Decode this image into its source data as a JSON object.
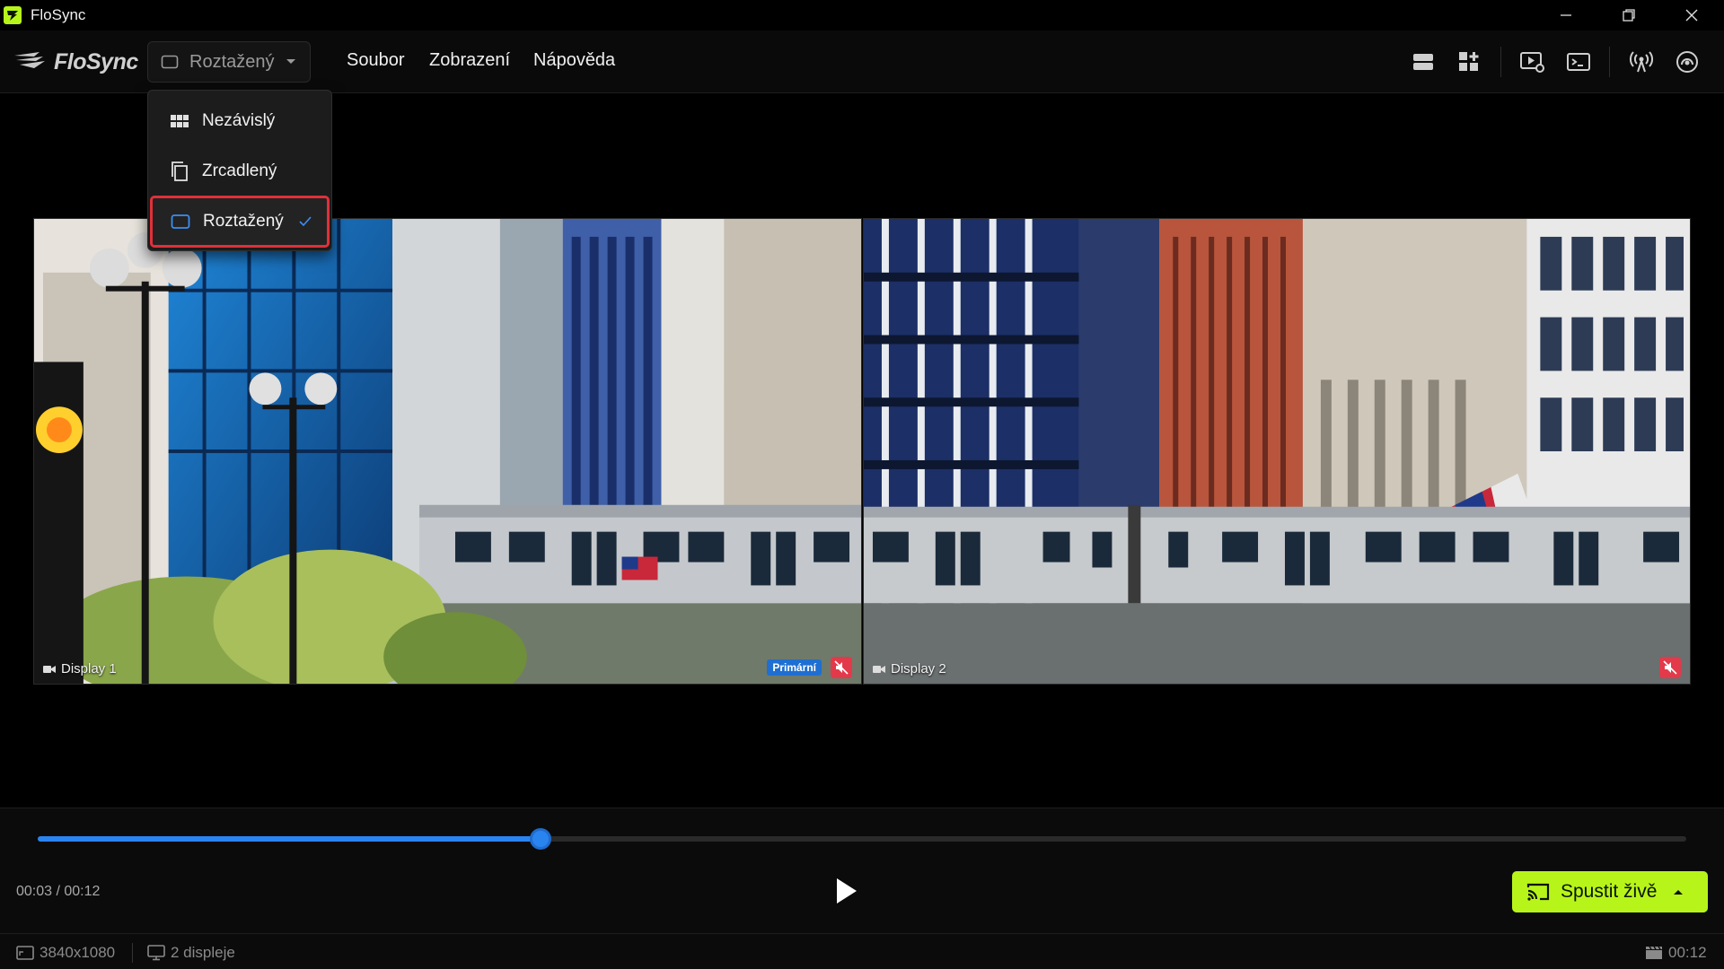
{
  "window": {
    "title": "FloSync",
    "controls": [
      "minimize-icon",
      "restore-icon",
      "close-icon"
    ]
  },
  "menubar": {
    "logo_text": "FloSync",
    "mode_selector": {
      "value": "Roztažený",
      "icon": "display-outline-icon"
    },
    "menus": [
      "Soubor",
      "Zobrazení",
      "Nápověda"
    ],
    "toolbar_icons": [
      "layout-rows-icon",
      "layout-grid-add-icon",
      "play-settings-icon",
      "terminal-icon",
      "broadcast-icon",
      "fingerprint-signal-icon"
    ]
  },
  "dropdown": {
    "items": [
      {
        "label": "Nezávislý",
        "icon": "grid-icon",
        "selected": false
      },
      {
        "label": "Zrcadlený",
        "icon": "copy-icon",
        "selected": false
      },
      {
        "label": "Roztažený",
        "icon": "display-outline-icon",
        "selected": true
      }
    ]
  },
  "displays": [
    {
      "label": "Display 1",
      "badge": "Primární",
      "muted": true
    },
    {
      "label": "Display 2",
      "badge": "",
      "muted": true
    }
  ],
  "playback": {
    "time_current": "00:03",
    "time_total": "00:12",
    "time_text": "00:03 / 00:12",
    "progress": 0.305,
    "live_button_label": "Spustit živě"
  },
  "statusbar": {
    "resolution": "3840x1080",
    "displays_count": "2 displeje",
    "duration": "00:12"
  },
  "colors": {
    "accent_blue": "#2a84f0",
    "live_green": "#b7f51a",
    "selection_red": "#e0303a",
    "mute_red": "#e23a4a",
    "primary_badge": "#1e6fd1"
  }
}
